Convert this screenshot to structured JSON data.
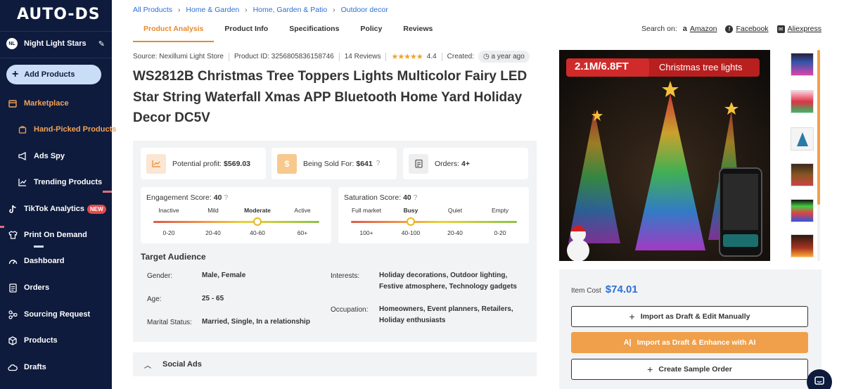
{
  "sidebar": {
    "logo": "AUTO-DS",
    "store": {
      "initials": "NL",
      "name": "Night Light Stars"
    },
    "add_products": "Add Products",
    "items": [
      {
        "label": "Marketplace"
      },
      {
        "label": "Hand-Picked Products"
      },
      {
        "label": "Ads Spy"
      },
      {
        "label": "Trending Products"
      },
      {
        "label": "TikTok Analytics",
        "badge": "NEW"
      },
      {
        "label": "Print On Demand"
      },
      {
        "label": "Dashboard"
      },
      {
        "label": "Orders"
      },
      {
        "label": "Sourcing Request"
      },
      {
        "label": "Products"
      },
      {
        "label": "Drafts"
      }
    ]
  },
  "breadcrumb": [
    "All Products",
    "Home & Garden",
    "Home, Garden & Patio",
    "Outdoor decor"
  ],
  "tabs": [
    "Product Analysis",
    "Product Info",
    "Specifications",
    "Policy",
    "Reviews"
  ],
  "search_on": {
    "label": "Search on:",
    "links": [
      "Amazon",
      "Facebook",
      "Aliexpress"
    ]
  },
  "meta": {
    "source": "Source: Nexillumi Light Store",
    "product_id": "Product ID: 3256805836158746",
    "reviews": "14 Reviews",
    "rating": "4.4",
    "rating_stars": 4.4,
    "created_label": "Created:",
    "created_value": "a year ago"
  },
  "product_title": "WS2812B Christmas Tree Toppers Lights Multicolor Fairy LED Star String Waterfall Xmas APP Bluetooth Home Yard Holiday Decor DC5V",
  "stats": {
    "profit_label": "Potential profit:",
    "profit_value": "$569.03",
    "sold_label": "Being Sold For:",
    "sold_value": "$641",
    "orders_label": "Orders:",
    "orders_value": "4+"
  },
  "engagement": {
    "title": "Engagement Score:",
    "score": "40",
    "levels": [
      "Inactive",
      "Mild",
      "Moderate",
      "Active"
    ],
    "ranges": [
      "0-20",
      "20-40",
      "40-60",
      "60+"
    ],
    "active_index": 2
  },
  "saturation": {
    "title": "Saturation Score:",
    "score": "40",
    "levels": [
      "Full market",
      "Busy",
      "Quiet",
      "Empty"
    ],
    "ranges": [
      "100+",
      "40-100",
      "20-40",
      "0-20"
    ],
    "active_index": 1
  },
  "target_audience": {
    "title": "Target Audience",
    "gender_label": "Gender:",
    "gender_value": "Male, Female",
    "age_label": "Age:",
    "age_value": "25 - 65",
    "marital_label": "Marital Status:",
    "marital_value": "Married, Single, In a relationship",
    "interests_label": "Interests:",
    "interests_value": "Holiday decorations, Outdoor lighting, Festive atmosphere, Technology gadgets",
    "occupation_label": "Occupation:",
    "occupation_value": "Homeowners, Event planners, Retailers, Holiday enthusiasts"
  },
  "social_ads": "Social Ads",
  "image": {
    "banner_size": "2.1M/6.8FT",
    "banner_text": "Christmas tree lights"
  },
  "price": {
    "item_cost_label": "Item Cost",
    "item_cost_value": "$74.01",
    "btn_draft_manual": "Import as Draft & Edit Manually",
    "btn_draft_ai": "Import as Draft & Enhance with AI",
    "btn_sample": "Create Sample Order"
  },
  "colors": {
    "sidebar_bg": "#0e1b3d",
    "accent_orange": "#e8882e",
    "link_blue": "#2c6fd6"
  }
}
